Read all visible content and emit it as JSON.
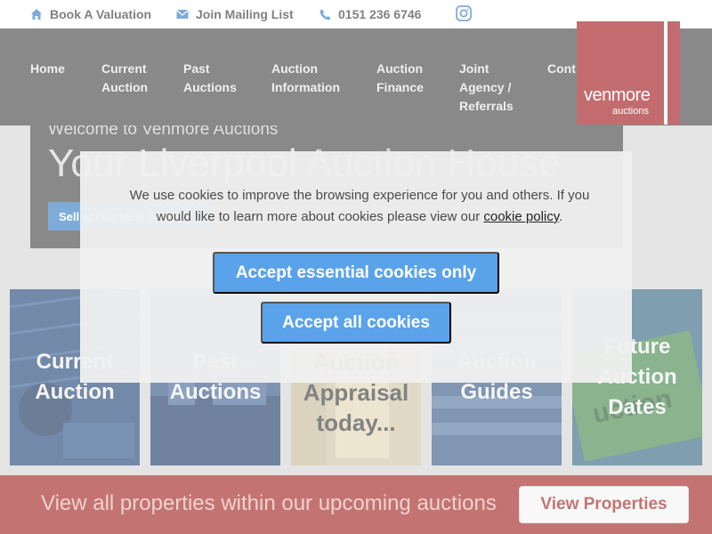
{
  "topbar": {
    "valuation": {
      "label": "Book A Valuation",
      "icon": "home-icon"
    },
    "mailing": {
      "label": "Join Mailing List",
      "icon": "mail-icon"
    },
    "phone": {
      "label": "0151 236 6746",
      "icon": "phone-icon"
    },
    "instagram": {
      "icon": "instagram-icon"
    }
  },
  "nav": {
    "items": [
      {
        "label": "Home"
      },
      {
        "label": "Current\nAuction"
      },
      {
        "label": "Past\nAuctions"
      },
      {
        "label": "Auction\nInformation"
      },
      {
        "label": "Auction\nFinance"
      },
      {
        "label": "Joint\nAgency /\nReferrals"
      },
      {
        "label": "Cont"
      }
    ]
  },
  "logo": {
    "name": "venmore",
    "sub": "auctions"
  },
  "hero": {
    "welcome": "Welcome to Venmore Auctions",
    "headline_main": "Your Liverpool ",
    "headline_dim": "Auction House",
    "cta": "Sell at Our Next Auction"
  },
  "tiles": [
    {
      "label": "Current\nAuction"
    },
    {
      "label": "Past\nAuctions"
    },
    {
      "label": "your free\nAuction\nAppraisal\ntoday..."
    },
    {
      "label": "Auction\nGuides"
    },
    {
      "label": "Future\nAuction\nDates"
    }
  ],
  "banner": {
    "text": "View all properties within our upcoming auctions",
    "button": "View Properties"
  },
  "cookie": {
    "message_before": "We use cookies to improve the browsing experience for you and others. If you would like to learn more about cookies please view our ",
    "link": "cookie policy",
    "message_after": ".",
    "accept_essential": "Accept essential cookies only",
    "accept_all": "Accept all cookies"
  },
  "colors": {
    "brand_red": "#a31e22",
    "accent_blue": "#5aa3ea",
    "nav_bg": "#4a4a4a"
  }
}
